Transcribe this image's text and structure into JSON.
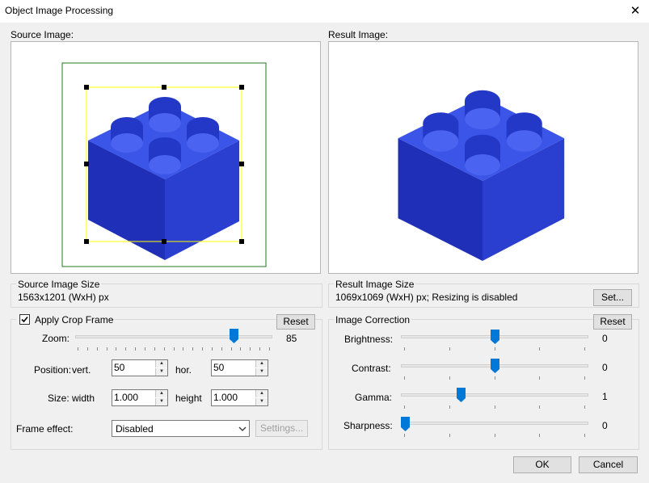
{
  "window": {
    "title": "Object Image Processing"
  },
  "source": {
    "label": "Source Image:"
  },
  "result": {
    "label": "Result Image:"
  },
  "source_size": {
    "label": "Source Image Size",
    "value": "1563x1201 (WxH) px"
  },
  "result_size": {
    "label": "Result Image Size",
    "value": "1069x1069 (WxH) px; Resizing is disabled",
    "set_label": "Set..."
  },
  "crop": {
    "checkbox_label": "Apply Crop Frame",
    "checked": true,
    "reset_label": "Reset",
    "zoom": {
      "label": "Zoom:",
      "value": "85",
      "level": 85
    },
    "position": {
      "label": "Position:",
      "vert_label": "vert.",
      "vert_value": "50",
      "hor_label": "hor.",
      "hor_value": "50"
    },
    "size": {
      "label": "Size:",
      "width_label": "width",
      "width_value": "1.000",
      "height_label": "height",
      "height_value": "1.000"
    },
    "frame_effect": {
      "label": "Frame effect:",
      "selected": "Disabled",
      "settings_label": "Settings..."
    }
  },
  "correction": {
    "label": "Image Correction",
    "reset_label": "Reset",
    "brightness": {
      "label": "Brightness:",
      "value": "0",
      "level": 0
    },
    "contrast": {
      "label": "Contrast:",
      "value": "0",
      "level": 0
    },
    "gamma": {
      "label": "Gamma:",
      "value": "1",
      "level": 1
    },
    "sharpness": {
      "label": "Sharpness:",
      "value": "0",
      "level": 0
    }
  },
  "buttons": {
    "ok": "OK",
    "cancel": "Cancel"
  },
  "colors": {
    "accent": "#0078d7",
    "brick": "#2a3fd0",
    "crop_frame": "#ffff00",
    "outer_frame": "#1e7a1e"
  }
}
